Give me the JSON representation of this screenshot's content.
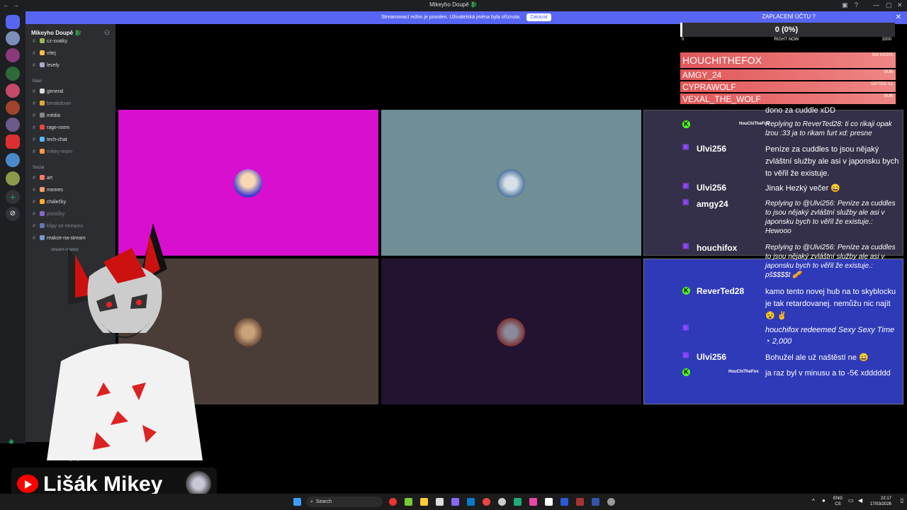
{
  "window": {
    "title": "Mikeyho Doupě 🐉"
  },
  "banner": {
    "text": "Streamovací režim je povolen. Uživatelská jména byla oříznuta.",
    "dismiss_label": "Zakázat"
  },
  "server": {
    "name": "Mikeyho Doupě 🐉",
    "channels_top": [
      {
        "name": "cz-svatky",
        "dim": false
      },
      {
        "name": "vítej",
        "dim": false
      },
      {
        "name": "levely",
        "dim": false
      }
    ],
    "category_main": "Main",
    "channels_main": [
      {
        "name": "general",
        "dim": false
      },
      {
        "name": "breakdown",
        "dim": true
      },
      {
        "name": "média",
        "dim": false
      },
      {
        "name": "rage-room",
        "dim": false
      },
      {
        "name": "tech-chat",
        "dim": false
      },
      {
        "name": "mikey-team",
        "dim": true
      }
    ],
    "category_social": "Social",
    "channels_social": [
      {
        "name": "art",
        "dim": false
      },
      {
        "name": "memes",
        "dim": false
      },
      {
        "name": "chálečky",
        "dim": false
      },
      {
        "name": "písničky",
        "dim": true
      },
      {
        "name": "klipy-ze-streamu",
        "dim": true
      },
      {
        "name": "reakce-na-stream",
        "dim": false
      }
    ],
    "category_stream": "stream-related"
  },
  "stats": {
    "label": "ZAPLACENÍ ÚČTU ?",
    "value": "0 (0%)",
    "min": "0",
    "now": "RIGHT NOW",
    "max": "3300",
    "progress": 0.0
  },
  "leaderboard": [
    {
      "name": "HOUCHITHEFOX",
      "badge": "500 KICKS"
    },
    {
      "name": "AMGY_24",
      "badge": "SUB"
    },
    {
      "name": "CYPRAWOLF",
      "badge": "GIFTED X1"
    },
    {
      "name": "VEXAL_THE_WOLF",
      "badge": "SUB"
    }
  ],
  "chat": [
    {
      "platform": "none",
      "user": "",
      "text": "dono za cuddle xDD",
      "reply": false
    },
    {
      "platform": "kick",
      "user": "HouChiTheFox",
      "text": "Replying to ReverTed28: ti co rikaji opak lzou :33 ja to rikam furt xd:  presne",
      "reply": true
    },
    {
      "platform": "twitch",
      "user": "Ulvi256",
      "text": "Peníze za cuddles to jsou nějaký zvláštní služby ale asi v japonsku bych to věřil že existuje.",
      "reply": false
    },
    {
      "platform": "twitch",
      "user": "Ulvi256",
      "text": "Jinak Hezký večer 😄",
      "reply": false
    },
    {
      "platform": "twitch",
      "user": "amgy24",
      "text": "Replying to @Ulvi256: Peníze za cuddles to jsou nějaký zvláštní služby ale asi v japonsku bych to věřil že existuje.: Hewooo",
      "reply": true
    },
    {
      "platform": "twitch",
      "user": "houchifox",
      "text": "Replying to @Ulvi256: Peníze za cuddles to jsou nějaký zvláštní služby ale asi v japonsku bych to věřil že existuje.: pš$$$$t 🥜",
      "reply": true
    },
    {
      "platform": "kick",
      "user": "ReverTed28",
      "text": "kamo tento novej hub na to skyblocku je tak retardovanej. nemůžu nic najít 😵 ✌️",
      "reply": false
    },
    {
      "platform": "twitch",
      "user": "",
      "text": "houchifox redeemed Sexy Sexy Time ◔ 2,000",
      "reply": true
    },
    {
      "platform": "twitch",
      "user": "Ulvi256",
      "text": "Bohužel ale už naštěstí ne 😄",
      "reply": false
    },
    {
      "platform": "kick",
      "user": "HouChiTheFox",
      "text": "ja raz byl v minusu a to -5€ xdddddd",
      "reply": false
    }
  ],
  "streamer": {
    "name": "Lišák Mikey"
  },
  "taskbar": {
    "search_placeholder": "Search",
    "lang1": "ENG",
    "lang2": "CS",
    "time": "22:17",
    "date": "17/03/2026"
  },
  "colors": {
    "tile1": "#d90fd0",
    "tile2": "#6f8e96",
    "tile3": "#4a3d38",
    "tile4": "#221331",
    "discord_blurple": "#5865f2"
  }
}
